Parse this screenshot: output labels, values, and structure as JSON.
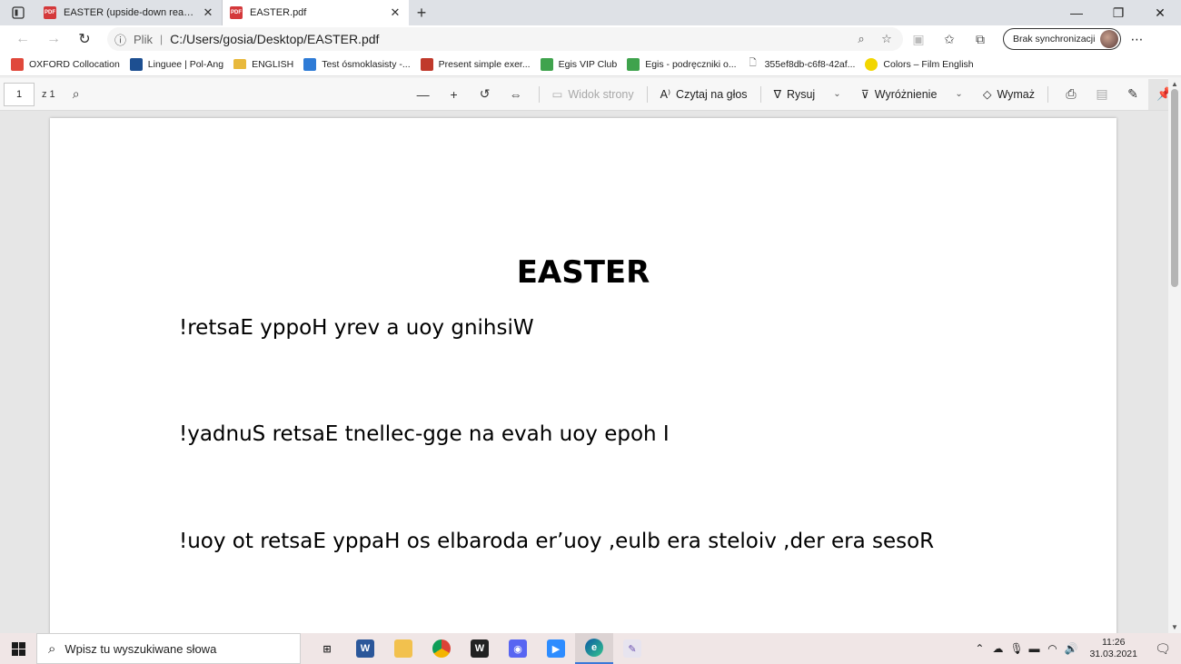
{
  "tabs": [
    {
      "title": "EASTER (upside-down reading).p",
      "active": false
    },
    {
      "title": "EASTER.pdf",
      "active": true
    }
  ],
  "address": {
    "scheme_label": "Plik",
    "url": "C:/Users/gosia/Desktop/EASTER.pdf",
    "sync_label": "Brak synchronizacji"
  },
  "favorites": [
    {
      "label": "OXFORD Collocation",
      "icon": "oxford-icon",
      "color": "#e0483b"
    },
    {
      "label": "Linguee | Pol-Ang",
      "icon": "linguee-icon",
      "color": "#1d4f91"
    },
    {
      "label": "ENGLISH",
      "icon": "folder-icon",
      "color": "#e8b93c"
    },
    {
      "label": "Test ósmoklasisty -...",
      "icon": "test-icon",
      "color": "#2e7bd6"
    },
    {
      "label": "Present simple exer...",
      "icon": "engram-icon",
      "color": "#c0392b"
    },
    {
      "label": "Egis VIP Club",
      "icon": "egis-icon",
      "color": "#3fa34d"
    },
    {
      "label": "Egis - podręczniki o...",
      "icon": "egis-icon",
      "color": "#3fa34d"
    },
    {
      "label": "355ef8db-c6f8-42af...",
      "icon": "file-icon",
      "color": "#555555"
    },
    {
      "label": "Colors – Film English",
      "icon": "yellow-dot-icon",
      "color": "#f2d600"
    }
  ],
  "pdf_toolbar": {
    "page_number": "1",
    "page_count": "z 1",
    "page_view_label": "Widok strony",
    "read_aloud_label": "Czytaj na głos",
    "draw_label": "Rysuj",
    "highlight_label": "Wyróżnienie",
    "erase_label": "Wymaż"
  },
  "document": {
    "title": "EASTER",
    "lines": [
      "!retsaE yppoH yrev a uoy gnihsiW",
      "!yadnuS retsaE tnellec-gge na evah uoy epoh I",
      "!uoy ot retsaE yppaH os elbaroda er’uoy ,eulb era steloiv ,der era sesoR"
    ]
  },
  "taskbar": {
    "search_placeholder": "Wpisz tu wyszukiwane słowa",
    "apps": [
      "task-view-icon",
      "word-icon",
      "file-explorer-icon",
      "chrome-icon",
      "wordwall-icon",
      "discord-icon",
      "zoom-icon",
      "edge-icon",
      "paint-icon"
    ],
    "time": "11:26",
    "date": "31.03.2021"
  }
}
